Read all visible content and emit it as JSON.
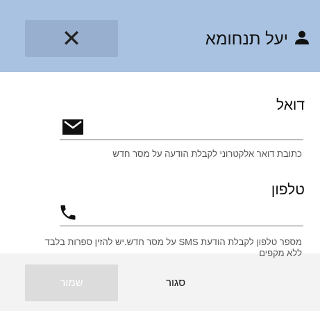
{
  "header": {
    "user_name": "יעל תנחומא",
    "user_icon": "person-icon",
    "close_label": "✕",
    "background": "#a9c2e1"
  },
  "email": {
    "label": "דואל",
    "icon": "envelope-icon",
    "value": "",
    "helper": "כתובת דואר אלקטרוני לקבלת הודעה על מסר חדש"
  },
  "phone": {
    "label": "טלפון",
    "icon": "phone-icon",
    "value": "",
    "helper": "מספר טלפון לקבלת הודעת SMS על מסר חדש.יש להזין ספרות בלבד ללא מקפים"
  },
  "footer": {
    "save_label": "שמור",
    "cancel_label": "סגור"
  }
}
